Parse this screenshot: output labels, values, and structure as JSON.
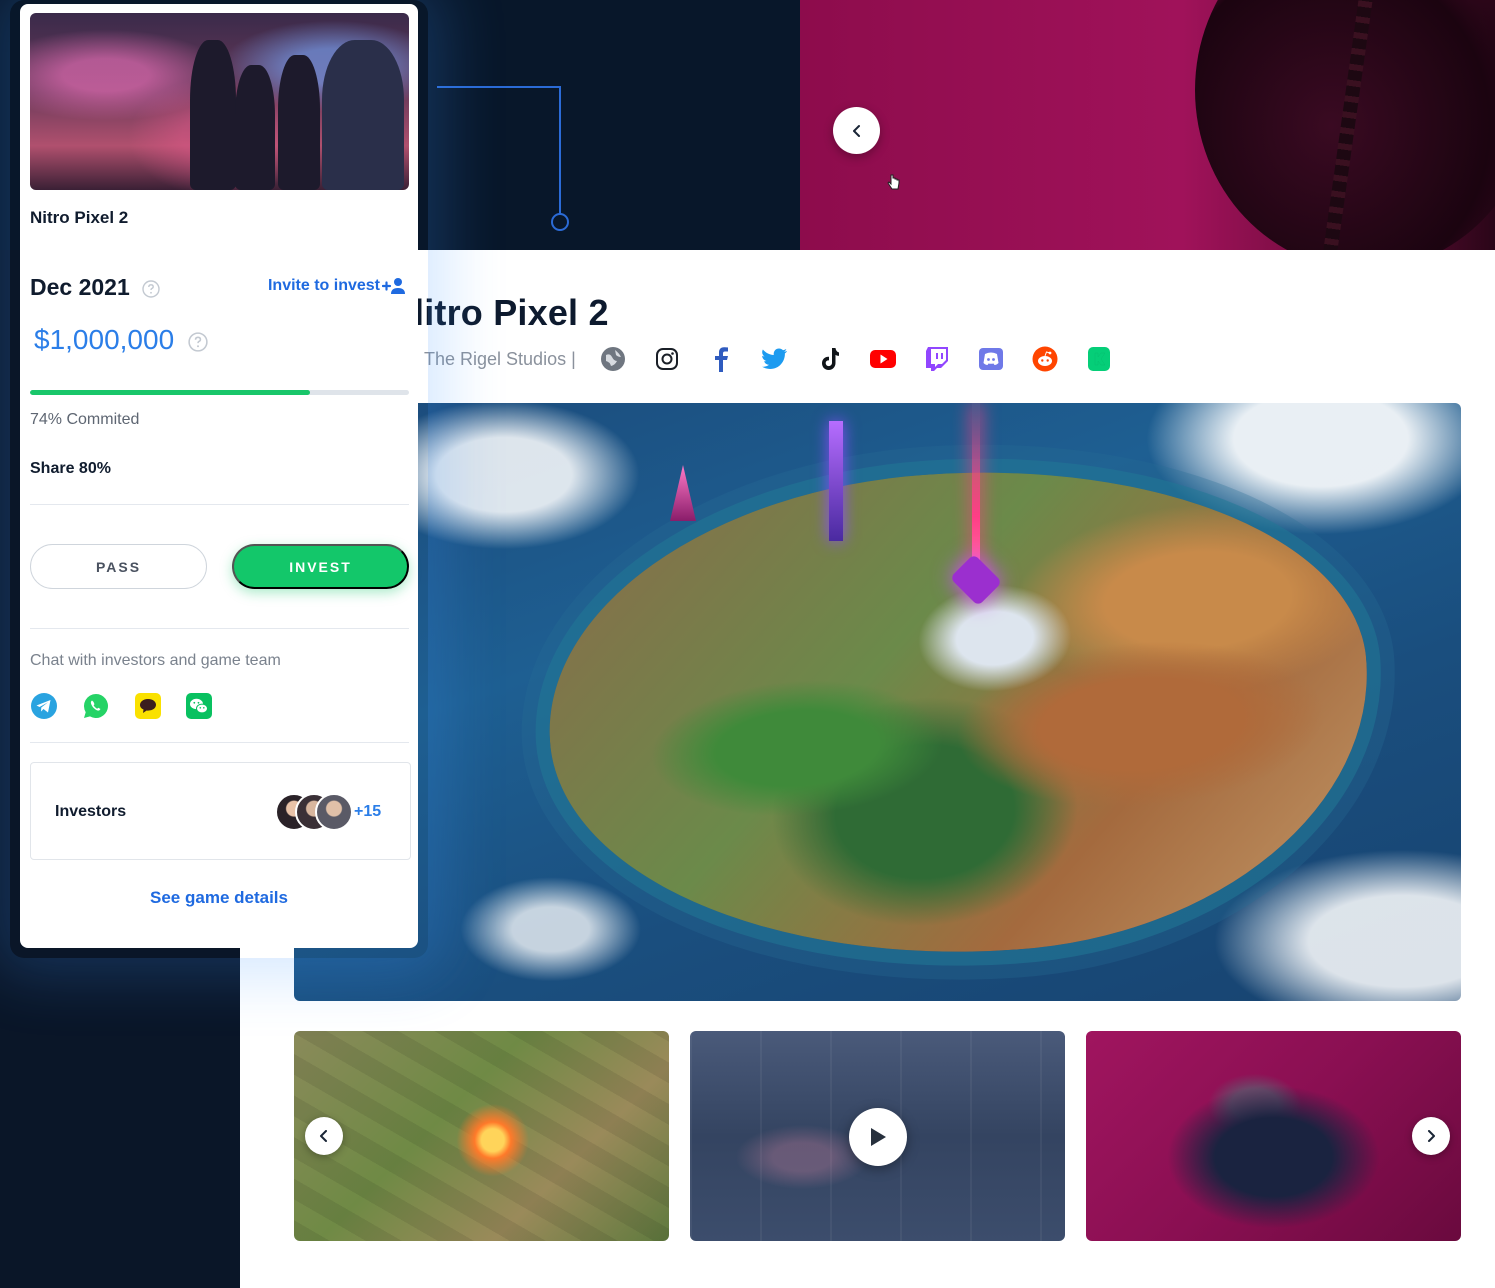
{
  "card": {
    "title": "Nitro Pixel 2",
    "date": "Dec 2021",
    "invite_label": "Invite to invest",
    "amount": "$1,000,000",
    "progress_fraction": 0.74,
    "commited_label": "74% Commited",
    "share_label": "Share 80%",
    "pass_label": "PASS",
    "invest_label": "INVEST",
    "chat_label": "Chat with investors and game team",
    "chat_icons": [
      "telegram-icon",
      "whatsapp-icon",
      "kakaotalk-icon",
      "wechat-icon"
    ],
    "investors_label": "Investors",
    "investors_extra": "+15",
    "see_details_label": "See game details"
  },
  "game": {
    "title": "Nitro Pixel 2",
    "visible_title": "litro Pixel 2",
    "studio": "The Rigel Studios |",
    "social_icons": [
      "globe-icon",
      "instagram-icon",
      "facebook-icon",
      "twitter-icon",
      "tiktok-icon",
      "youtube-icon",
      "twitch-icon",
      "discord-icon",
      "reddit-icon",
      "kickstarter-icon"
    ]
  },
  "colors": {
    "accent_blue": "#2b7ee8",
    "link_blue": "#1f6ae0",
    "invest_green": "#13c76a",
    "progress_green": "#19c66a",
    "hero_magenta": "#a0125a",
    "page_dark": "#0a1628"
  }
}
